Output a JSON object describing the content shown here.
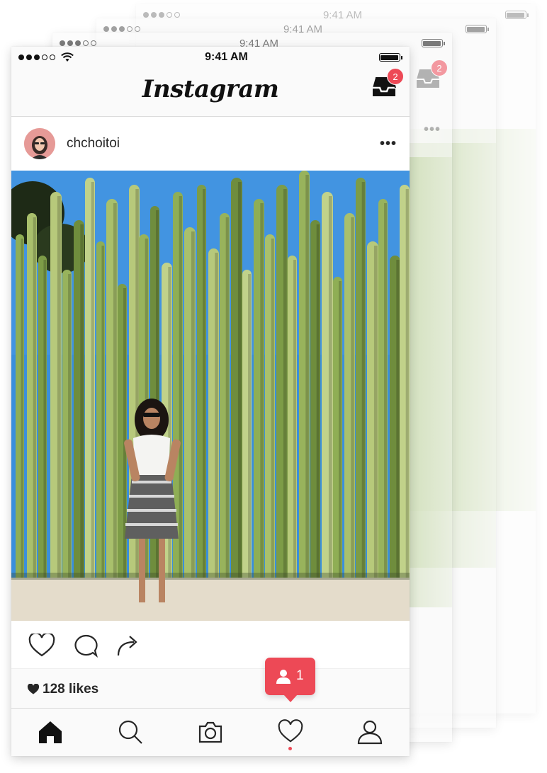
{
  "status_bar": {
    "time": "9:41 AM"
  },
  "app": {
    "logo": "Instagram"
  },
  "inbox": {
    "icon": "inbox-icon",
    "badge": "2"
  },
  "post": {
    "username": "chchoitoi",
    "more": "•••",
    "likes": "128 likes"
  },
  "actions": [
    "heart-icon",
    "comment-icon",
    "share-icon"
  ],
  "tabs": [
    "home-icon",
    "search-icon",
    "camera-icon",
    "activity-heart-icon",
    "profile-icon"
  ],
  "notification": {
    "icon": "person-icon",
    "count": "1"
  },
  "colors": {
    "accent": "#ed4956",
    "sky": "#3a8fdc",
    "cactus": "#9cb565",
    "sand": "#e4dccb"
  }
}
